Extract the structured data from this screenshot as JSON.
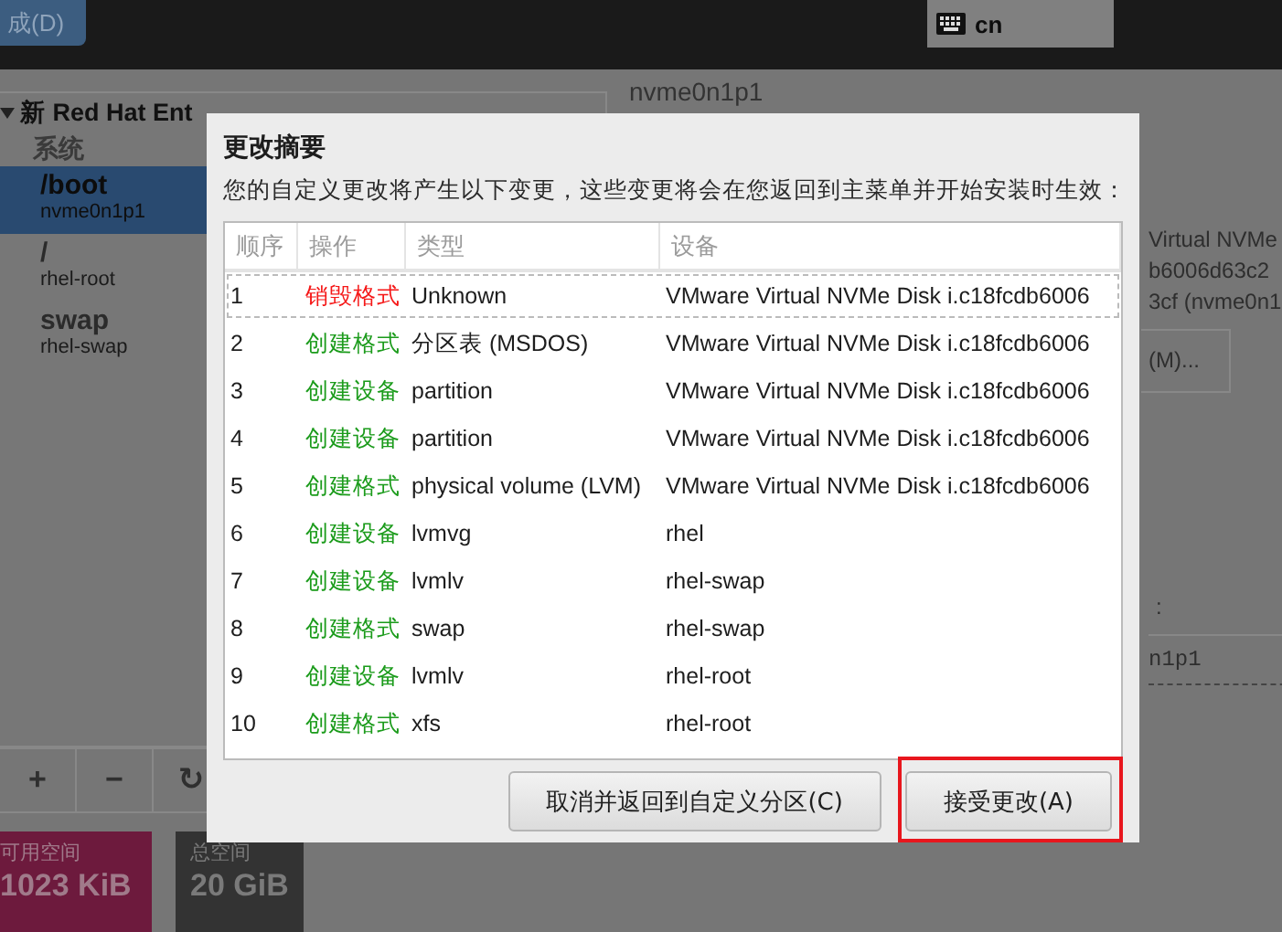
{
  "top_bar": {
    "done_button": "成(D)",
    "keyboard": "cn"
  },
  "left_panel": {
    "title": "新 Red Hat Ent",
    "section": "系统",
    "items": [
      {
        "mount": "/boot",
        "device": "nvme0n1p1",
        "selected": true
      },
      {
        "mount": "/",
        "device": "rhel-root",
        "selected": false
      },
      {
        "mount": "swap",
        "device": "rhel-swap",
        "selected": false
      }
    ],
    "tools": [
      "+",
      "−",
      "↻"
    ]
  },
  "space": [
    {
      "label": "可用空间",
      "value": "1023 KiB",
      "kind": "available"
    },
    {
      "label": "总空间",
      "value": "20 GiB",
      "kind": "total"
    }
  ],
  "right_panel": {
    "heading": "nvme0n1p1",
    "details": [
      "Virtual NVMe",
      "b6006d63c2",
      "3cf (nvme0n1"
    ],
    "modify_button": "(M)...",
    "label": ":",
    "field": "n1p1"
  },
  "dialog": {
    "title": "更改摘要",
    "description": "您的自定义更改将产生以下变更，这些变更将会在您返回到主菜单并开始安装时生效：",
    "table": {
      "columns": [
        "顺序",
        "操作",
        "类型",
        "设备"
      ],
      "rows": [
        {
          "order": "1",
          "action": "销毁格式",
          "kind": "destroy",
          "type": "Unknown",
          "device": "VMware Virtual NVMe Disk i.c18fcdb6006",
          "selected": true
        },
        {
          "order": "2",
          "action": "创建格式",
          "kind": "create",
          "type": "分区表 (MSDOS)",
          "device": "VMware Virtual NVMe Disk i.c18fcdb6006",
          "selected": false
        },
        {
          "order": "3",
          "action": "创建设备",
          "kind": "create",
          "type": "partition",
          "device": "VMware Virtual NVMe Disk i.c18fcdb6006",
          "selected": false
        },
        {
          "order": "4",
          "action": "创建设备",
          "kind": "create",
          "type": "partition",
          "device": "VMware Virtual NVMe Disk i.c18fcdb6006",
          "selected": false
        },
        {
          "order": "5",
          "action": "创建格式",
          "kind": "create",
          "type": "physical volume (LVM)",
          "device": "VMware Virtual NVMe Disk i.c18fcdb6006",
          "selected": false
        },
        {
          "order": "6",
          "action": "创建设备",
          "kind": "create",
          "type": "lvmvg",
          "device": "rhel",
          "selected": false
        },
        {
          "order": "7",
          "action": "创建设备",
          "kind": "create",
          "type": "lvmlv",
          "device": "rhel-swap",
          "selected": false
        },
        {
          "order": "8",
          "action": "创建格式",
          "kind": "create",
          "type": "swap",
          "device": "rhel-swap",
          "selected": false
        },
        {
          "order": "9",
          "action": "创建设备",
          "kind": "create",
          "type": "lvmlv",
          "device": "rhel-root",
          "selected": false
        },
        {
          "order": "10",
          "action": "创建格式",
          "kind": "create",
          "type": "xfs",
          "device": "rhel-root",
          "selected": false
        }
      ]
    },
    "buttons": [
      {
        "label": "取消并返回到自定义分区(C)",
        "highlighted": false
      },
      {
        "label": "接受更改(A)",
        "highlighted": true
      }
    ]
  }
}
